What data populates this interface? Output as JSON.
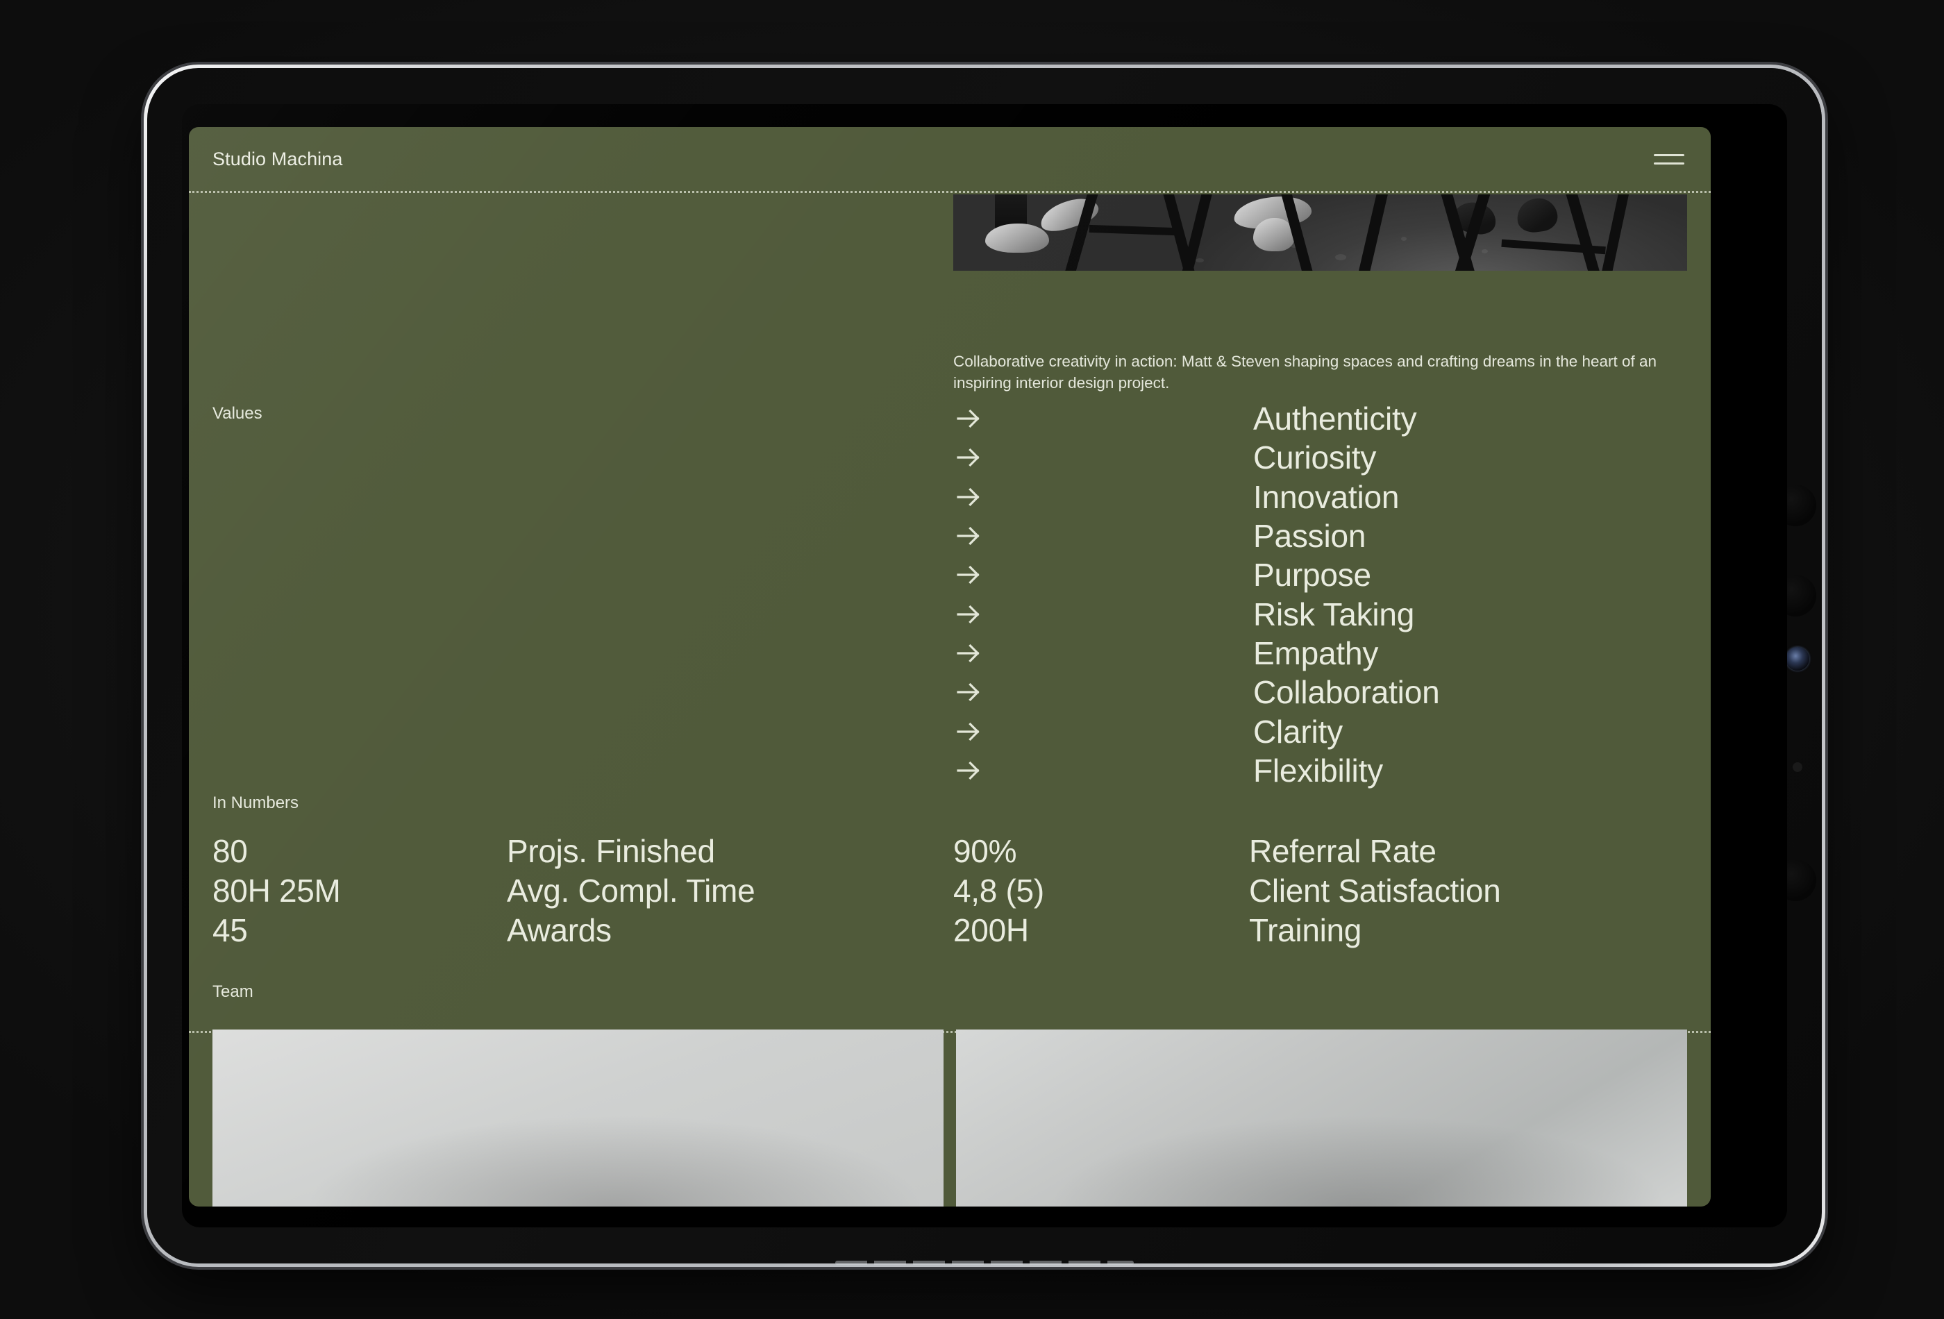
{
  "device": {
    "kind": "tablet",
    "frame_color": "#c4c7cb",
    "bezel_color": "#0d0d0d"
  },
  "theme": {
    "background": "#505a3a",
    "text": "#e9ecdf",
    "rule": "#e2e6d6",
    "placeholder": "#d2d4d3"
  },
  "header": {
    "brand": "Studio Machina",
    "menu_icon": "hamburger-menu-icon"
  },
  "hero": {
    "image_alt": "black-and-white photo of two people's legs and shoes beside sawhorse trestles on a concrete floor",
    "caption": "Collaborative creativity in action: Matt & Steven shaping spaces and crafting dreams in the heart of an inspiring interior design project."
  },
  "values": {
    "label": "Values",
    "arrow_icon": "arrow-right-icon",
    "items": [
      "Authenticity",
      "Curiosity",
      "Innovation",
      "Passion",
      "Purpose",
      "Risk Taking",
      "Empathy",
      "Collaboration",
      "Clarity",
      "Flexibility"
    ]
  },
  "numbers": {
    "label": "In Numbers",
    "rows": [
      {
        "value_left": "80",
        "label_left": "Projs. Finished",
        "value_right": "90%",
        "label_right": "Referral Rate"
      },
      {
        "value_left": "80H 25M",
        "label_left": "Avg. Compl. Time",
        "value_right": "4,8 (5)",
        "label_right": "Client Satisfaction"
      },
      {
        "value_left": "45",
        "label_left": "Awards",
        "value_right": "200H",
        "label_right": "Training"
      }
    ]
  },
  "team": {
    "label": "Team",
    "cards": [
      {
        "alt": "team member photo placeholder"
      },
      {
        "alt": "team member photo placeholder"
      }
    ]
  },
  "system": {
    "home_indicator": "home-indicator-bar"
  }
}
